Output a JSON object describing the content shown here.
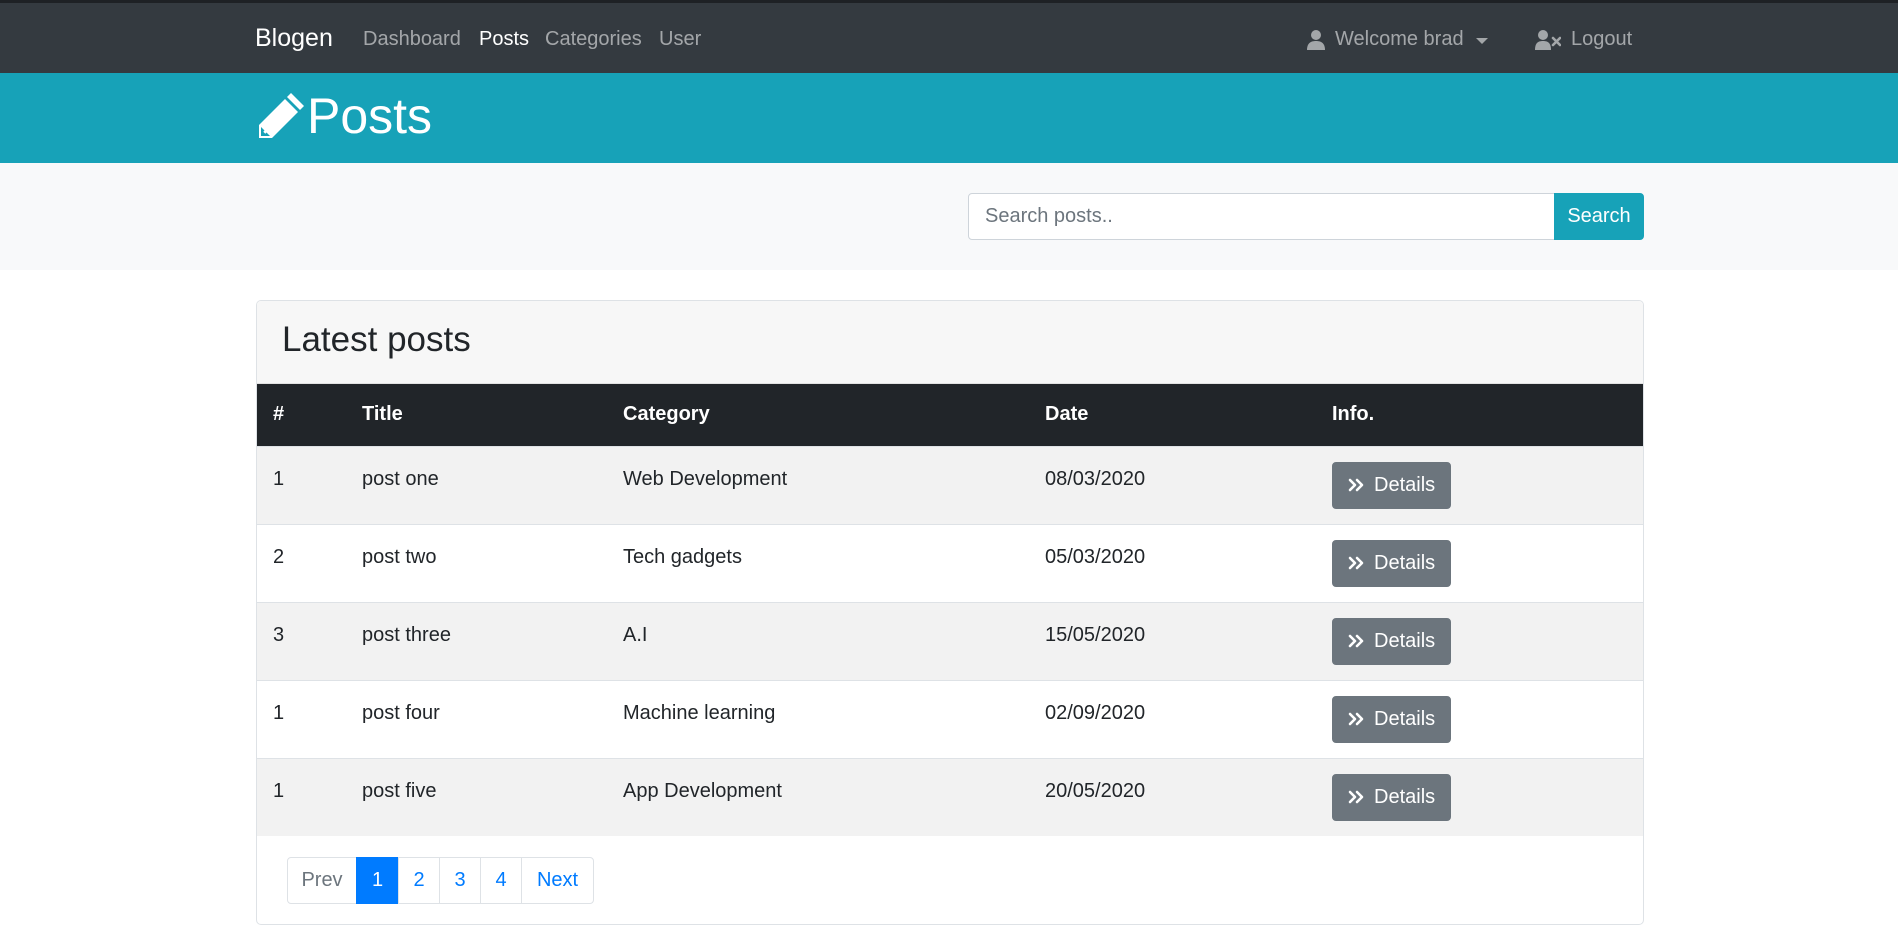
{
  "navbar": {
    "brand": "Blogen",
    "links": [
      {
        "label": "Dashboard",
        "active": false
      },
      {
        "label": "Posts",
        "active": true
      },
      {
        "label": "Categories",
        "active": false
      },
      {
        "label": "User",
        "active": false
      }
    ],
    "welcome_label": "Welcome brad",
    "logout_label": "Logout"
  },
  "header": {
    "title": "Posts",
    "icon": "pencil-icon"
  },
  "search": {
    "placeholder": "Search posts..",
    "value": "",
    "button_label": "Search"
  },
  "card": {
    "title": "Latest posts"
  },
  "table": {
    "columns": [
      "#",
      "Title",
      "Category",
      "Date",
      "Info."
    ],
    "rows": [
      {
        "num": "1",
        "title": "post one",
        "category": "Web Development",
        "date": "08/03/2020",
        "action": "Details"
      },
      {
        "num": "2",
        "title": "post two",
        "category": "Tech gadgets",
        "date": "05/03/2020",
        "action": "Details"
      },
      {
        "num": "3",
        "title": "post three",
        "category": "A.I",
        "date": "15/05/2020",
        "action": "Details"
      },
      {
        "num": "1",
        "title": "post four",
        "category": "Machine learning",
        "date": "02/09/2020",
        "action": "Details"
      },
      {
        "num": "1",
        "title": "post five",
        "category": "App Development",
        "date": "20/05/2020",
        "action": "Details"
      }
    ]
  },
  "pagination": {
    "prev_label": "Prev",
    "pages": [
      "1",
      "2",
      "3",
      "4"
    ],
    "current": "1",
    "next_label": "Next"
  },
  "colors": {
    "navbar": "#343a40",
    "header": "#17a2b8",
    "primary": "#007bff",
    "secondary": "#6c757d",
    "table_head": "#212529"
  }
}
